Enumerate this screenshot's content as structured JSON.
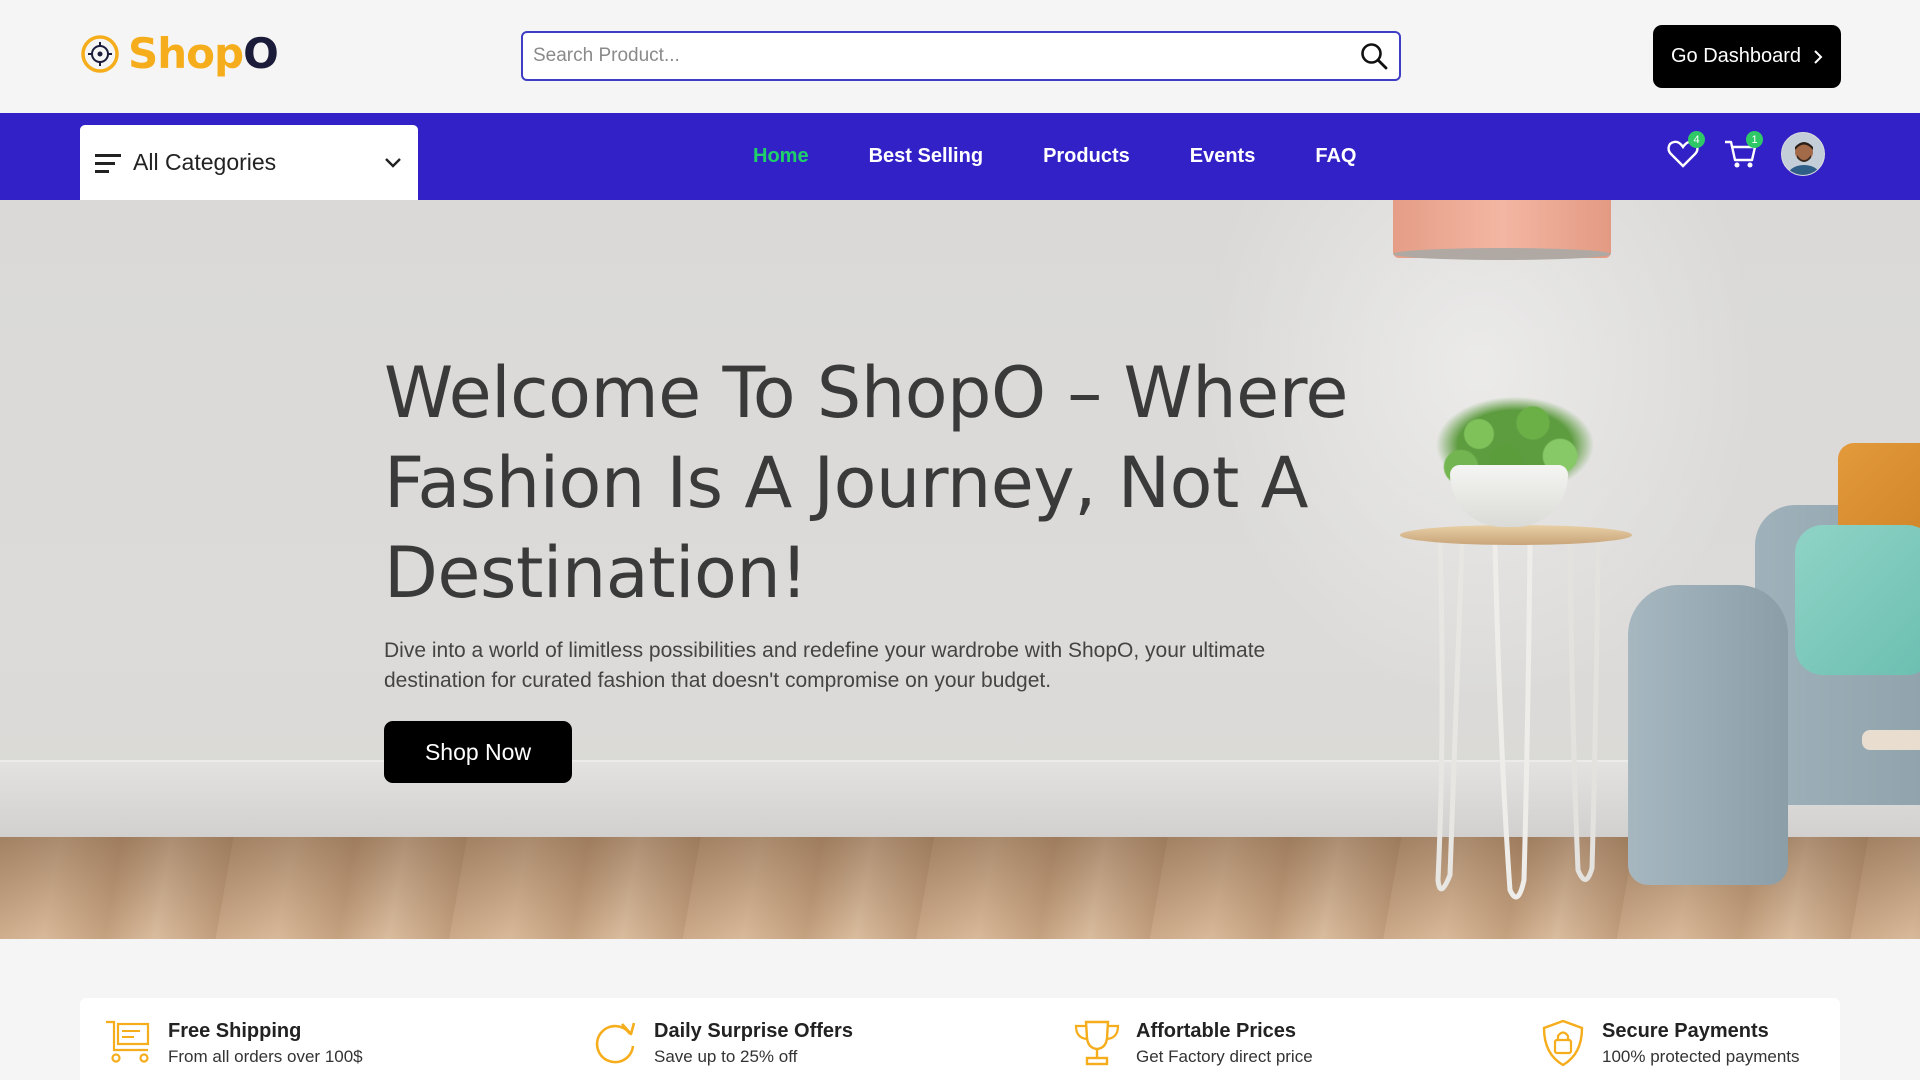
{
  "header": {
    "logo_text_main": "Shop",
    "logo_text_end": "O",
    "search_placeholder": "Search Product...",
    "dashboard_button": "Go Dashboard"
  },
  "nav": {
    "categories_label": "All Categories",
    "links": [
      {
        "label": "Home",
        "active": true
      },
      {
        "label": "Best Selling",
        "active": false
      },
      {
        "label": "Products",
        "active": false
      },
      {
        "label": "Events",
        "active": false
      },
      {
        "label": "FAQ",
        "active": false
      }
    ],
    "wishlist_count": "4",
    "cart_count": "1"
  },
  "hero": {
    "title": "Welcome To ShopO – Where Fashion Is A Journey, Not A Destination!",
    "subtitle": "Dive into a world of limitless possibilities and redefine your wardrobe with ShopO, your ultimate destination for curated fashion that doesn't compromise on your budget.",
    "cta": "Shop Now"
  },
  "features": [
    {
      "title": "Free Shipping",
      "subtitle": "From all orders over 100$",
      "icon": "cart-icon"
    },
    {
      "title": "Daily Surprise Offers",
      "subtitle": "Save up to 25% off",
      "icon": "refresh-icon"
    },
    {
      "title": "Affortable Prices",
      "subtitle": "Get Factory direct price",
      "icon": "trophy-icon"
    },
    {
      "title": "Secure Payments",
      "subtitle": "100% protected payments",
      "icon": "shield-lock-icon"
    }
  ],
  "colors": {
    "brand": "#f6ad1c",
    "nav_bg": "#3321c8",
    "active_link": "#1fd06a",
    "badge": "#2fc867"
  }
}
